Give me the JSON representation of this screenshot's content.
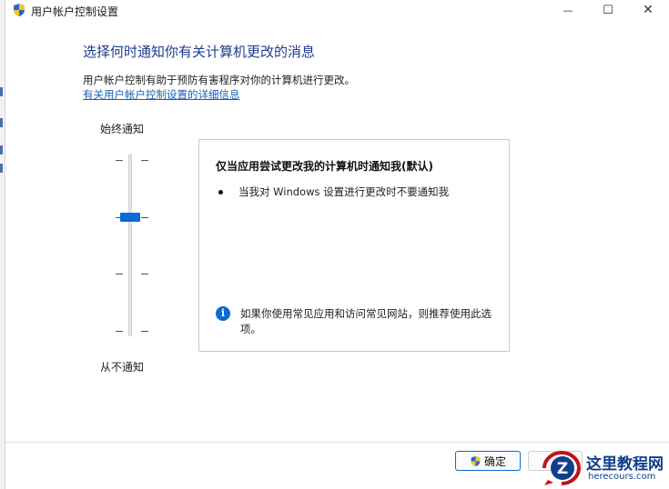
{
  "window": {
    "title": "用户帐户控制设置",
    "controls": {
      "minimize": "—",
      "maximize": "☐",
      "close": "✕"
    }
  },
  "main": {
    "heading": "选择何时通知你有关计算机更改的消息",
    "description": "用户帐户控制有助于预防有害程序对你的计算机进行更改。",
    "link": "有关用户帐户控制设置的详细信息"
  },
  "slider": {
    "top_label": "始终通知",
    "bottom_label": "从不通知",
    "levels": 4,
    "selected_level": 3,
    "accent_color": "#0a6bd0"
  },
  "panel": {
    "title": "仅当应用尝试更改我的计算机时通知我(默认)",
    "bullet": "当我对 Windows 设置进行更改时不要通知我",
    "info_icon": "i",
    "info": "如果你使用常见应用和访问常见网站，则推荐使用此选项。"
  },
  "footer": {
    "ok_label": "确定"
  },
  "watermark": {
    "title": "这里教程网",
    "url": "herecours.com"
  },
  "colors": {
    "heading": "#1c3d8c",
    "link": "#1a5fb4",
    "accent": "#0a6bd0"
  }
}
